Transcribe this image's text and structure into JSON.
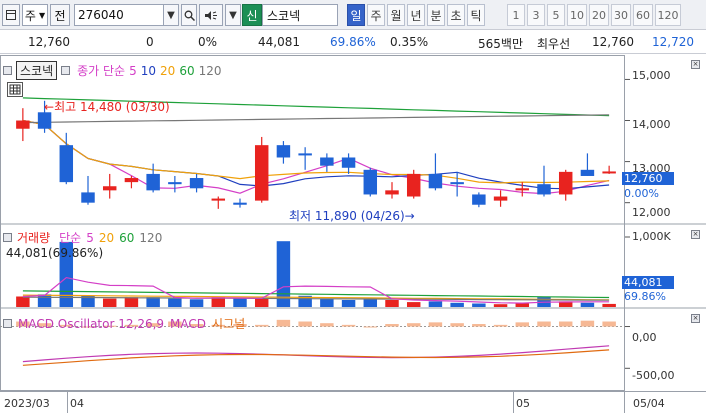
{
  "toolbar": {
    "market": "주",
    "code_mode": "전",
    "code": "276040",
    "signal_tab": "신",
    "indicator_select": "스코넥",
    "periods": [
      "일",
      "주",
      "월",
      "년",
      "분",
      "초",
      "틱"
    ],
    "active_period": "일",
    "numbers": [
      "1",
      "3",
      "5",
      "10",
      "20",
      "30",
      "60",
      "120"
    ]
  },
  "quote": {
    "price": "12,760",
    "change": "0",
    "change_pct": "0%",
    "volume": "44,081",
    "volume_ratio": "69.86%",
    "turnover": "0.35%",
    "amount": "565백만",
    "priority_label": "최우선",
    "ask": "12,760",
    "bid": "12,720"
  },
  "price_panel": {
    "stock_name": "스코넥",
    "ma_label": "종가 단순",
    "ma_periods": [
      "5",
      "10",
      "20",
      "60",
      "120"
    ],
    "high_annotation": "최고 14,480 (03/30)",
    "low_annotation": "최저 11,890 (04/26)",
    "current_tag": "12,760",
    "current_pct_tag": "0.00%"
  },
  "volume_panel": {
    "label": "거래량",
    "ma_label": "단순",
    "ma_periods": [
      "5",
      "20",
      "60",
      "120"
    ],
    "current_value": "44,081",
    "current_ratio": "(69.86%)",
    "tag_value": "44,081",
    "tag_pct": "69.86%"
  },
  "macd_panel": {
    "label_osc": "MACD Oscillator 12,26,9",
    "label_macd": "MACD",
    "label_signal": "시그널"
  },
  "axes": {
    "price_ticks": [
      "15,000",
      "14,000",
      "13,000",
      "12,000"
    ],
    "volume_ticks": [
      "1,000K"
    ],
    "macd_ticks": [
      "0,00",
      "-500,00"
    ],
    "date_labels": [
      "2023/03",
      "04",
      "05",
      "05/04"
    ]
  },
  "colors": {
    "up": "#e8231f",
    "down": "#1f63d6",
    "ma5": "#d43fc7",
    "ma10": "#1f3fbf",
    "ma20": "#f0a10a",
    "ma60": "#1ea13a",
    "ma120": "#777777",
    "active_tag_bg": "#1f63d6"
  },
  "chart_data": {
    "type": "candlestick",
    "ylim": [
      11700,
      15400
    ],
    "candles": [
      {
        "o": 13800,
        "h": 14300,
        "l": 13500,
        "c": 14000
      },
      {
        "o": 14200,
        "h": 14480,
        "l": 13700,
        "c": 13800
      },
      {
        "o": 13400,
        "h": 13700,
        "l": 12450,
        "c": 12500
      },
      {
        "o": 12250,
        "h": 12650,
        "l": 11950,
        "c": 12000
      },
      {
        "o": 12300,
        "h": 12700,
        "l": 12100,
        "c": 12400
      },
      {
        "o": 12500,
        "h": 12650,
        "l": 12350,
        "c": 12600
      },
      {
        "o": 12700,
        "h": 12950,
        "l": 12250,
        "c": 12300
      },
      {
        "o": 12500,
        "h": 12650,
        "l": 12250,
        "c": 12450
      },
      {
        "o": 12600,
        "h": 12700,
        "l": 12250,
        "c": 12350
      },
      {
        "o": 12050,
        "h": 12150,
        "l": 11850,
        "c": 12100
      },
      {
        "o": 12000,
        "h": 12100,
        "l": 11880,
        "c": 11950
      },
      {
        "o": 12050,
        "h": 13600,
        "l": 12000,
        "c": 13400
      },
      {
        "o": 13400,
        "h": 13500,
        "l": 12950,
        "c": 13100
      },
      {
        "o": 13200,
        "h": 13350,
        "l": 12800,
        "c": 13150
      },
      {
        "o": 13100,
        "h": 13200,
        "l": 12750,
        "c": 12900
      },
      {
        "o": 13100,
        "h": 13200,
        "l": 12700,
        "c": 12850
      },
      {
        "o": 12800,
        "h": 12850,
        "l": 12150,
        "c": 12200
      },
      {
        "o": 12200,
        "h": 12500,
        "l": 12100,
        "c": 12300
      },
      {
        "o": 12150,
        "h": 12800,
        "l": 12100,
        "c": 12700
      },
      {
        "o": 12700,
        "h": 13200,
        "l": 12300,
        "c": 12350
      },
      {
        "o": 12500,
        "h": 12750,
        "l": 12150,
        "c": 12450
      },
      {
        "o": 12200,
        "h": 12250,
        "l": 11890,
        "c": 11950
      },
      {
        "o": 12050,
        "h": 12300,
        "l": 11900,
        "c": 12150
      },
      {
        "o": 12300,
        "h": 12500,
        "l": 12150,
        "c": 12350
      },
      {
        "o": 12450,
        "h": 12900,
        "l": 12150,
        "c": 12200
      },
      {
        "o": 12200,
        "h": 12800,
        "l": 12050,
        "c": 12750
      },
      {
        "o": 12800,
        "h": 13200,
        "l": 12650,
        "c": 12650
      },
      {
        "o": 12760,
        "h": 12900,
        "l": 12700,
        "c": 12760
      }
    ],
    "volume_ylim": [
      0,
      1100000
    ],
    "volume": [
      150000,
      180000,
      930000,
      160000,
      120000,
      140000,
      140000,
      120000,
      110000,
      140000,
      130000,
      120000,
      940000,
      160000,
      120000,
      100000,
      110000,
      100000,
      70000,
      80000,
      60000,
      50000,
      40000,
      50000,
      140000,
      80000,
      60000,
      44081
    ],
    "macd_osc": [
      60,
      40,
      20,
      -10,
      10,
      20,
      40,
      60,
      30,
      20,
      30,
      20,
      80,
      60,
      40,
      20,
      -10,
      30,
      40,
      50,
      40,
      30,
      20,
      50,
      60,
      60,
      70,
      60
    ],
    "macd_ylim": [
      -700,
      150
    ]
  }
}
